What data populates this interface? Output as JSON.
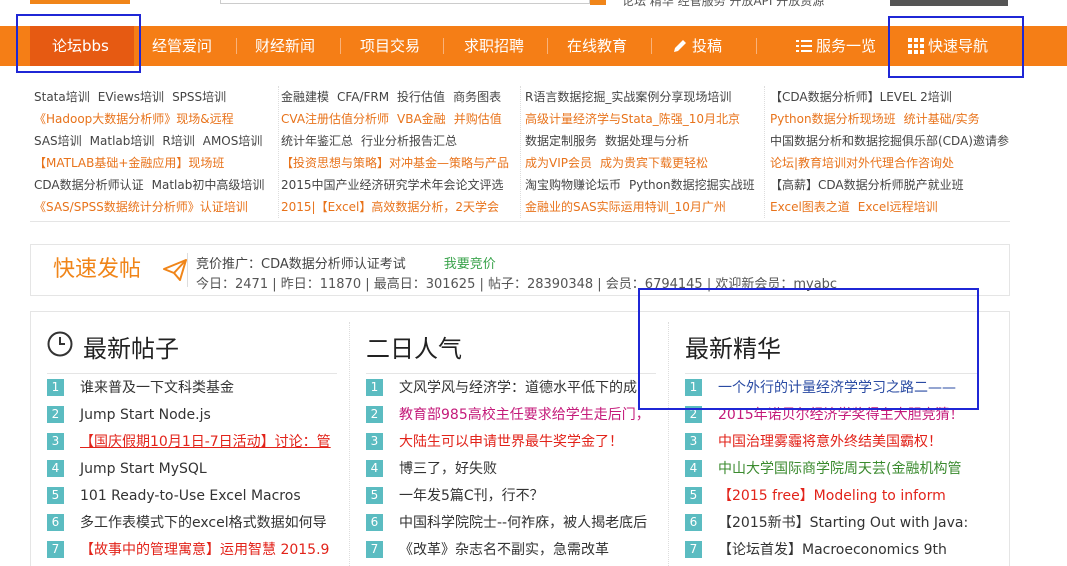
{
  "top": {
    "links": "论坛  精华  经管服务  开放API  开放资源"
  },
  "nav": {
    "items": [
      {
        "label": "论坛bbs",
        "active": true
      },
      {
        "label": "经管爱问"
      },
      {
        "label": "财经新闻"
      },
      {
        "label": "项目交易"
      },
      {
        "label": "求职招聘"
      },
      {
        "label": "在线教育"
      },
      {
        "label": "投稿",
        "icon": "pencil-icon"
      },
      {
        "label": "服务一览",
        "icon": "list-icon"
      },
      {
        "label": "快速导航",
        "icon": "grid-icon"
      }
    ]
  },
  "links": {
    "col1": [
      [
        "Stata培训",
        "EViews培训",
        "SPSS培训"
      ],
      [
        "《Hadoop大数据分析师》现场&远程"
      ],
      [
        "SAS培训",
        "Matlab培训",
        "R培训",
        "AMOS培训"
      ],
      [
        "【MATLAB基础+金融应用】现场班"
      ],
      [
        "CDA数据分析师认证",
        "Matlab初中高级培训"
      ],
      [
        "《SAS/SPSS数据统计分析师》认证培训"
      ]
    ],
    "col2": [
      [
        "金融建模",
        "CFA/FRM",
        "投行估值",
        "商务图表"
      ],
      [
        "CVA注册估值分析师",
        "VBA金融",
        "并购估值"
      ],
      [
        "统计年鉴汇总",
        "行业分析报告汇总"
      ],
      [
        "【投资思想与策略】对冲基金—策略与产品"
      ],
      [
        "2015中国产业经济研究学术年会论文评选"
      ],
      [
        "2015|【Excel】高效数据分析，2天学会"
      ]
    ],
    "col3": [
      [
        "R语言数据挖掘_实战案例分享现场培训"
      ],
      [
        "高级计量经济学与Stata_陈强_10月北京"
      ],
      [
        "数据定制服务",
        "数据处理与分析"
      ],
      [
        "成为VIP会员",
        "成为贵宾下载更轻松"
      ],
      [
        "淘宝购物赚论坛币",
        "Python数据挖掘实战班"
      ],
      [
        "金融业的SAS实际运用特训_10月广州"
      ]
    ],
    "col4": [
      [
        "【CDA数据分析师】LEVEL 2培训"
      ],
      [
        "Python数据分析现场班",
        "统计基础/实务"
      ],
      [
        "中国数据分析和数据挖掘俱乐部(CDA)邀请参"
      ],
      [
        "论坛|教育培训对外代理合作咨询处"
      ],
      [
        "【高薪】CDA数据分析师脱产就业班"
      ],
      [
        "Excel图表之道",
        "Excel远程培训"
      ]
    ]
  },
  "quick": {
    "post_label": "快速发帖",
    "promo_text": "竞价推广：CDA数据分析师认证考试",
    "promo_link": "我要竞价",
    "stats": "今日：2471  |  昨日：11870  |  最高日：301625  |  帖子：28390348  |  会员：6794145  |  欢迎新会员：myabc"
  },
  "panels": [
    {
      "title": "最新帖子",
      "icon": "clock-icon",
      "items": [
        {
          "n": "1",
          "text": "谁来普及一下文科类基金",
          "color": "#333333"
        },
        {
          "n": "2",
          "text": "Jump Start Node.js",
          "color": "#333333"
        },
        {
          "n": "3",
          "text": "【国庆假期10月1日-7日活动】讨论：管",
          "color": "#e2231a",
          "underline": true
        },
        {
          "n": "4",
          "text": "Jump Start MySQL",
          "color": "#333333"
        },
        {
          "n": "5",
          "text": "101 Ready-to-Use Excel Macros",
          "color": "#333333"
        },
        {
          "n": "6",
          "text": "多工作表模式下的excel格式数据如何导",
          "color": "#333333"
        },
        {
          "n": "7",
          "text": "【故事中的管理寓意】运用智慧 2015.9",
          "color": "#e2231a"
        }
      ]
    },
    {
      "title": "二日人气",
      "items": [
        {
          "n": "1",
          "text": "文风学风与经济学：道德水平低下的成",
          "color": "#333333"
        },
        {
          "n": "2",
          "text": "教育部985高校主任要求给学生走后门，",
          "color": "#c41a7a"
        },
        {
          "n": "3",
          "text": "大陆生可以申请世界最牛奖学金了！",
          "color": "#e2231a"
        },
        {
          "n": "4",
          "text": "博三了，好失败",
          "color": "#333333"
        },
        {
          "n": "5",
          "text": "一年发5篇C刊，行不？",
          "color": "#333333"
        },
        {
          "n": "6",
          "text": "中国科学院院士--何祚庥，被人揭老底后",
          "color": "#333333"
        },
        {
          "n": "7",
          "text": "《改革》杂志名不副实，急需改革",
          "color": "#333333"
        }
      ]
    },
    {
      "title": "最新精华",
      "items": [
        {
          "n": "1",
          "text": "一个外行的计量经济学学习之路二——",
          "color": "#2a4ba3"
        },
        {
          "n": "2",
          "text": "2015年诺贝尔经济学奖得主大胆竞猜！",
          "color": "#c41a7a"
        },
        {
          "n": "3",
          "text": "中国治理雾霾将意外终结美国霸权！",
          "color": "#e2231a"
        },
        {
          "n": "4",
          "text": "中山大学国际商学院周天芸(金融机构管",
          "color": "#3a8a2e"
        },
        {
          "n": "5",
          "text": "【2015 free】Modeling to inform",
          "color": "#e2231a"
        },
        {
          "n": "6",
          "text": "【2015新书】Starting Out with Java:",
          "color": "#333333"
        },
        {
          "n": "7",
          "text": "【论坛首发】Macroeconomics 9th",
          "color": "#333333"
        }
      ]
    }
  ]
}
